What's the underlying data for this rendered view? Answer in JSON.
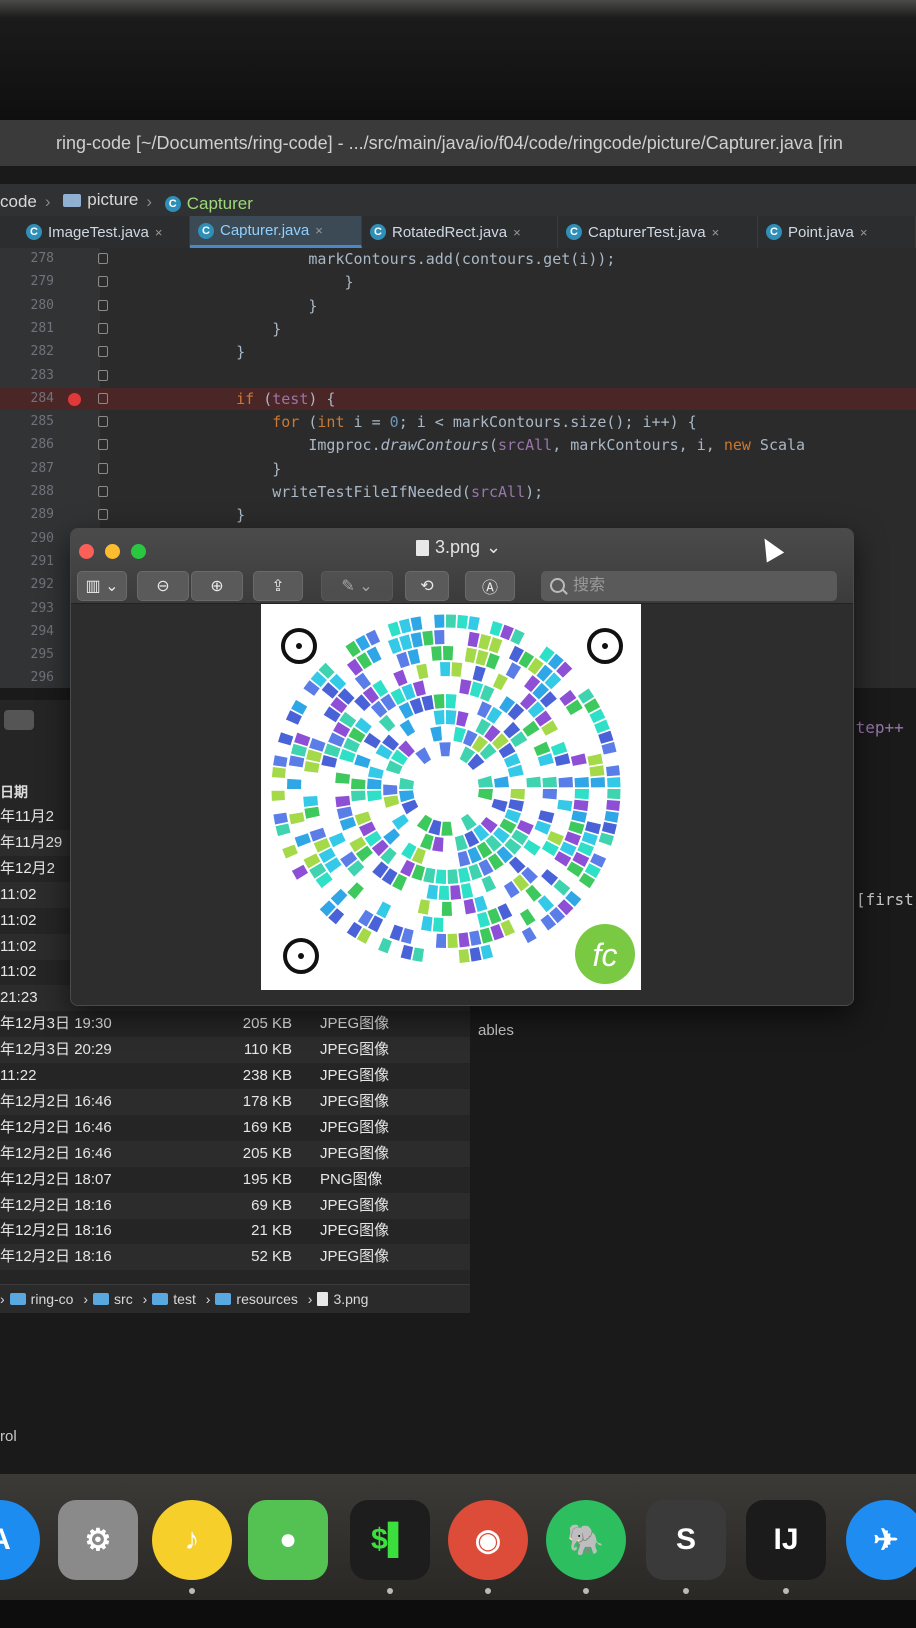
{
  "ide": {
    "title": "ring-code [~/Documents/ring-code] - .../src/main/java/io/f04/code/ringcode/picture/Capturer.java [rin",
    "breadcrumb": [
      "code",
      "picture",
      "Capturer"
    ],
    "tabs": [
      {
        "label": "ImageTest.java",
        "active": false
      },
      {
        "label": "Capturer.java",
        "active": true
      },
      {
        "label": "RotatedRect.java",
        "active": false
      },
      {
        "label": "CapturerTest.java",
        "active": false
      },
      {
        "label": "Point.java",
        "active": false
      }
    ],
    "tab_close": "×",
    "lines": [
      {
        "n": "278",
        "text": "            markContours.add(contours.get(i));"
      },
      {
        "n": "279",
        "text": "                }"
      },
      {
        "n": "280",
        "text": "            }"
      },
      {
        "n": "281",
        "text": "        }"
      },
      {
        "n": "282",
        "text": "    }"
      },
      {
        "n": "283",
        "text": ""
      },
      {
        "n": "284",
        "text": "    if (test) {"
      },
      {
        "n": "285",
        "text": "        for (int i = 0; i < markContours.size(); i++) {"
      },
      {
        "n": "286",
        "text": "            Imgproc.drawContours(srcAll, markContours, i, new Scala"
      },
      {
        "n": "287",
        "text": "        }"
      },
      {
        "n": "288",
        "text": "        writeTestFileIfNeeded(srcAll);"
      },
      {
        "n": "289",
        "text": "    }"
      },
      {
        "n": "290",
        "text": ""
      },
      {
        "n": "291",
        "text": ""
      },
      {
        "n": "292",
        "text": ""
      },
      {
        "n": "293",
        "text": ""
      },
      {
        "n": "294",
        "text": ""
      },
      {
        "n": "295",
        "text": ""
      },
      {
        "n": "296",
        "text": ""
      }
    ],
    "right_fragments": {
      "step": "step++",
      "first": "[first",
      "ables": "ables",
      "rol": "rol"
    }
  },
  "finder": {
    "header": "日期",
    "rows": [
      {
        "date": "年11月2",
        "size": "",
        "kind": ""
      },
      {
        "date": "年11月29",
        "size": "",
        "kind": ""
      },
      {
        "date": "年12月2",
        "size": "",
        "kind": ""
      },
      {
        "date": "11:02",
        "size": "",
        "kind": ""
      },
      {
        "date": "11:02",
        "size": "",
        "kind": ""
      },
      {
        "date": "11:02",
        "size": "",
        "kind": ""
      },
      {
        "date": "11:02",
        "size": "",
        "kind": ""
      },
      {
        "date": "21:23",
        "size": "",
        "kind": ""
      },
      {
        "date": "年12月3日 19:30",
        "size": "205 KB",
        "kind": "JPEG图像"
      },
      {
        "date": "年12月3日 20:29",
        "size": "110 KB",
        "kind": "JPEG图像"
      },
      {
        "date": "11:22",
        "size": "238 KB",
        "kind": "JPEG图像"
      },
      {
        "date": "年12月2日 16:46",
        "size": "178 KB",
        "kind": "JPEG图像"
      },
      {
        "date": "年12月2日 16:46",
        "size": "169 KB",
        "kind": "JPEG图像"
      },
      {
        "date": "年12月2日 16:46",
        "size": "205 KB",
        "kind": "JPEG图像"
      },
      {
        "date": "年12月2日 18:07",
        "size": "195 KB",
        "kind": "PNG图像"
      },
      {
        "date": "年12月2日 18:16",
        "size": "69 KB",
        "kind": "JPEG图像"
      },
      {
        "date": "年12月2日 18:16",
        "size": "21 KB",
        "kind": "JPEG图像"
      },
      {
        "date": "年12月2日 18:16",
        "size": "52 KB",
        "kind": "JPEG图像"
      }
    ],
    "path": [
      "ring-co",
      "src",
      "test",
      "resources",
      "3.png"
    ]
  },
  "preview": {
    "title": "3.png",
    "search_placeholder": "搜索",
    "logo_text": "fc",
    "colors": {
      "close": "#fc5f57",
      "minimize": "#fdbc2e",
      "zoom": "#28c840"
    }
  },
  "dock": {
    "apps": [
      {
        "name": "app-store",
        "color": "#1c8cf0",
        "glyph": "A"
      },
      {
        "name": "system-preferences",
        "color": "#8a8a8a",
        "glyph": "⚙"
      },
      {
        "name": "qq-music",
        "color": "#f6cf2b",
        "glyph": "♪"
      },
      {
        "name": "wechat",
        "color": "#53c253",
        "glyph": "●"
      },
      {
        "name": "terminal",
        "color": "#1d1d1d",
        "glyph": "$▌"
      },
      {
        "name": "chrome",
        "color": "#dd4b39",
        "glyph": "◉"
      },
      {
        "name": "evernote",
        "color": "#2dbe60",
        "glyph": "🐘"
      },
      {
        "name": "sublime-text",
        "color": "#3a3a3a",
        "glyph": "S"
      },
      {
        "name": "intellij-idea",
        "color": "#1b1b1b",
        "glyph": "IJ"
      },
      {
        "name": "dingtalk",
        "color": "#1e8cf0",
        "glyph": "✈"
      }
    ]
  }
}
